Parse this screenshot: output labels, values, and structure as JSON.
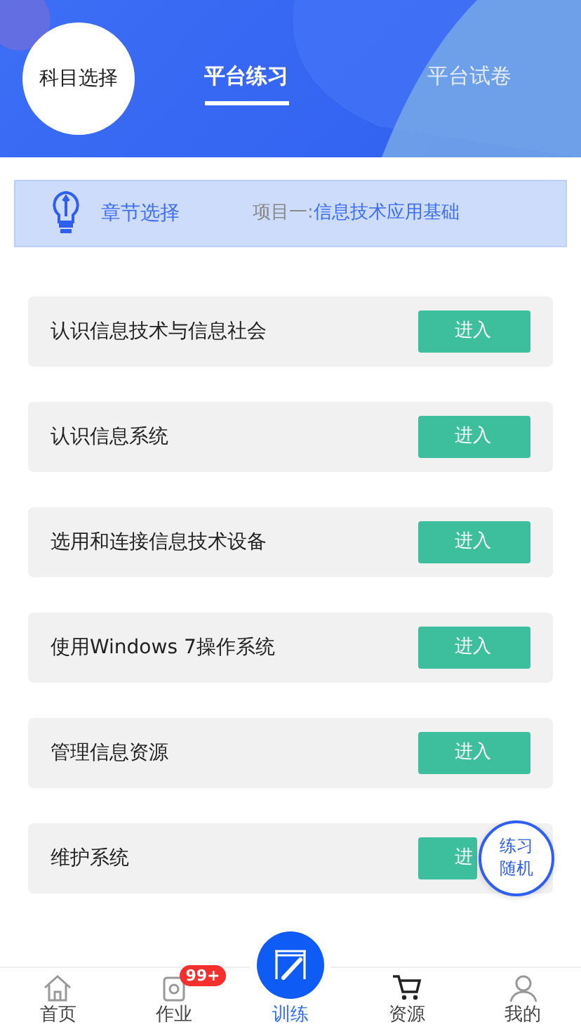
{
  "header": {
    "subject_button": "科目选择",
    "tabs": [
      {
        "label": "平台练习",
        "selected": true
      },
      {
        "label": "平台试卷",
        "selected": false
      }
    ]
  },
  "chapter_bar": {
    "label": "章节选择",
    "project_prefix": "项目一:",
    "project_name": "信息技术应用基础"
  },
  "lessons": [
    {
      "title": "认识信息技术与信息社会",
      "button": "进入"
    },
    {
      "title": "认识信息系统",
      "button": "进入"
    },
    {
      "title": "选用和连接信息技术设备",
      "button": "进入"
    },
    {
      "title": "使用Windows 7操作系统",
      "button": "进入"
    },
    {
      "title": "管理信息资源",
      "button": "进入"
    },
    {
      "title": "维护系统",
      "button": "进"
    }
  ],
  "float_button": "练习随机",
  "bottom_nav": [
    {
      "label": "首页",
      "kind": "home",
      "selected": false
    },
    {
      "label": "作业",
      "kind": "homework",
      "selected": false,
      "badge": "99+"
    },
    {
      "label": "训练",
      "kind": "training",
      "selected": true
    },
    {
      "label": "资源",
      "kind": "cart",
      "selected": false
    },
    {
      "label": "我的",
      "kind": "user",
      "selected": false
    }
  ]
}
